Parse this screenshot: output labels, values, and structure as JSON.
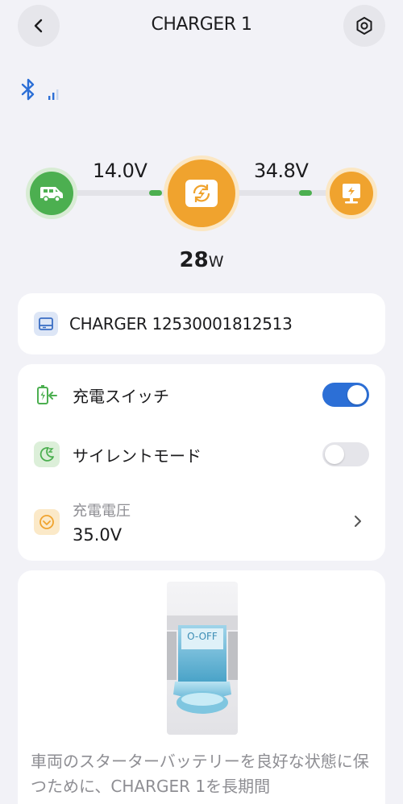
{
  "header": {
    "title": "CHARGER 1"
  },
  "flow": {
    "input_voltage": "14.0V",
    "output_voltage": "34.8V",
    "power_value": "28",
    "power_unit": "W"
  },
  "device": {
    "name": "CHARGER 12530001812513"
  },
  "settings": {
    "charge_switch": {
      "label": "充電スイッチ",
      "enabled": true
    },
    "silent_mode": {
      "label": "サイレントモード",
      "enabled": false
    },
    "charge_voltage": {
      "label": "充電電圧",
      "value": "35.0V"
    }
  },
  "info": {
    "breaker_label": "O-OFF",
    "text": "車両のスターターバッテリーを良好な状態に保つために、CHARGER 1を長期間"
  },
  "colors": {
    "accent_blue": "#2c6fd6",
    "green": "#4caf50",
    "orange": "#f0a32e",
    "background": "#f2f2f7"
  },
  "icons": {
    "back": "chevron-left-icon",
    "settings": "gear-icon",
    "bluetooth": "bluetooth-icon",
    "signal": "signal-icon",
    "vehicle": "van-icon",
    "charger": "charger-icon",
    "solar": "solar-panel-icon"
  }
}
